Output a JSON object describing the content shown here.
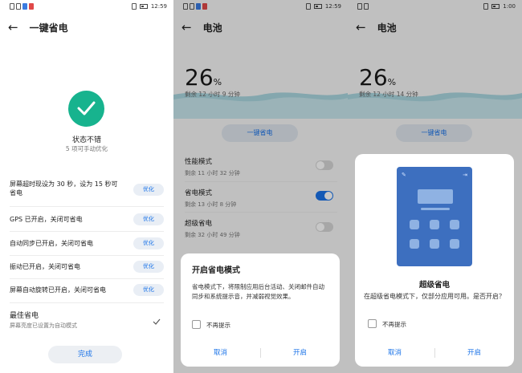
{
  "panel1": {
    "status": {
      "time": "12:59"
    },
    "title": "一键省电",
    "status_text": "状态不错",
    "sub_text": "5 项可手动优化",
    "items": [
      {
        "label": "屏幕超时现设为 30 秒，设为 15 秒可省电",
        "button": "优化"
      },
      {
        "label": "GPS 已开启，关闭可省电",
        "button": "优化"
      },
      {
        "label": "自动同步已开启，关闭可省电",
        "button": "优化"
      },
      {
        "label": "振动已开启，关闭可省电",
        "button": "优化"
      },
      {
        "label": "屏幕自动旋转已开启，关闭可省电",
        "button": "优化"
      }
    ],
    "best_title": "最佳省电",
    "best_sub": "屏幕亮度已设置为自动模式",
    "done": "完成"
  },
  "panel2": {
    "status": {
      "time": "12:59"
    },
    "title": "电池",
    "percent": "26",
    "percent_unit": "%",
    "remaining": "剩余 12 小时 9 分钟",
    "onekey": "一键省电",
    "modes": [
      {
        "title": "性能模式",
        "sub": "剩余 11 小时 32 分钟",
        "on": false
      },
      {
        "title": "省电模式",
        "sub": "剩余 13 小时 8 分钟",
        "on": true
      },
      {
        "title": "超级省电",
        "sub": "剩余 32 小时 49 分钟",
        "on": false
      }
    ],
    "dialog": {
      "title": "开启省电模式",
      "body": "省电模式下，将限制应用后台活动、关闭邮件自动同步和系统提示音，并减弱视觉效果。",
      "checkbox": "不再提示",
      "cancel": "取消",
      "confirm": "开启"
    }
  },
  "panel3": {
    "status": {
      "time": "1:00"
    },
    "title": "电池",
    "percent": "26",
    "percent_unit": "%",
    "remaining": "剩余 12 小时 14 分钟",
    "onekey": "一键省电",
    "dialog": {
      "title": "超级省电",
      "body": "在超级省电模式下，仅部分应用可用。是否开启？",
      "checkbox": "不再提示",
      "cancel": "取消",
      "confirm": "开启"
    }
  },
  "colors": {
    "accent": "#1a73e8",
    "success": "#17b38e",
    "illustration": "#3d6fbf"
  }
}
